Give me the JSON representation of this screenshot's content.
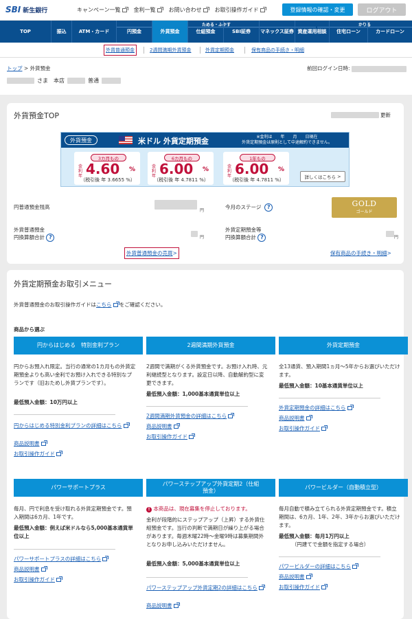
{
  "header": {
    "logo_sbi": "SBI",
    "logo_bank": "新生銀行",
    "links": [
      "キャンペーン一覧",
      "金利一覧",
      "お問い合わせ",
      "お取引操作ガイド"
    ],
    "register_button": "登録情報の確認・変更",
    "logout_button": "ログアウト"
  },
  "nav": {
    "groups": [
      "ためる・ふやす",
      "かりる"
    ],
    "items": [
      "TOP",
      "振込",
      "ATM・カード",
      "円預金",
      "外貨預金",
      "仕組預金",
      "SBI証券",
      "マネックス証券",
      "資産運用相談",
      "住宅ローン",
      "カードローン"
    ],
    "active": "外貨預金"
  },
  "subnav": {
    "items": [
      "外貨普通預金",
      "2週間満期外貨預金",
      "外貨定期預金",
      "保有商品の手続き・明細"
    ]
  },
  "breadcrumb": {
    "home": "トップ",
    "sep": " > ",
    "current": "外貨預金"
  },
  "last_login_label": "前回ログイン日時:",
  "account": {
    "honorific": "さま",
    "branch": "本店",
    "type": "普通"
  },
  "panel1": {
    "title": "外貨預金TOP",
    "updated_suffix": "更新",
    "banner": {
      "tag": "外貨預金",
      "title": "米ドル 外貨定期預金",
      "note_line1": "※金利は　　年　　月　　日現在",
      "note_line2": "外貨定期預金は原則として中途解約できません。",
      "rate_label": "金利年",
      "rates": [
        {
          "term": "3カ月もの",
          "rate": "4.60",
          "pct": "%",
          "tax": "（税引後 年 3.6655 %）"
        },
        {
          "term": "6カ月もの",
          "rate": "6.00",
          "pct": "%",
          "tax": "（税引後 年 4.7811 %）"
        },
        {
          "term": "1年もの",
          "rate": "6.00",
          "pct": "%",
          "tax": "（税引後 年 4.7811 %）"
        }
      ],
      "detail_button": "詳しくはこちら"
    },
    "yen_balance_label": "円普通預金残高",
    "fx_total_label_1": "外貨普通預金",
    "fx_total_label_2": "円換算額合計",
    "stage_label": "今月のステージ",
    "stage_value": "GOLD",
    "stage_sub": "ゴールド",
    "fixed_total_label_1": "外貨定期預金等",
    "fixed_total_label_2": "円換算額合計",
    "yen_unit": "円",
    "sale_link": "外貨普通預金の売買",
    "history_link": "保有商品の手続き・明細"
  },
  "panel2": {
    "title": "外貨定期預金お取引メニュー",
    "guide_prefix": "外貨普通預金のお取引操作ガイドは",
    "guide_link": "こちら",
    "guide_suffix": "をご確認ください。",
    "select_label": "商品から選ぶ",
    "products": [
      {
        "button": "円からはじめる　特別金利プラン",
        "desc": "円からお預入れ限定。当行の通常の1カ月もの外貨定期預金よりも高い金利でお預け入れできる特別なプランです（旧おためし外貨プランです）。",
        "min": "最低預入金額：10万円以上",
        "links": [
          "円からはじめる特別金利プランの詳細はこちら",
          "商品説明書",
          "お取引操作ガイド"
        ]
      },
      {
        "button": "2週間満期外貨預金",
        "desc": "2週間で満期がくる外貨預金です。お預け入れ時、元利継続型となります。設定日以降、自動解約型に変更できます。",
        "min": "最低預入金額：1,000基本通貨単位以上",
        "links": [
          "2週間満期外貨預金の詳細はこちら",
          "商品説明書",
          "お取引操作ガイド"
        ]
      },
      {
        "button": "外貨定期預金",
        "desc": "全13通貨、預入期間1ヵ月〜5年からお選びいただけます。",
        "min": "最低預入金額：10基本通貨単位以上",
        "links": [
          "外貨定期預金の詳細はこちら",
          "商品説明書",
          "お取引操作ガイド"
        ]
      },
      {
        "button": "パワーサポートプラス",
        "desc": "毎月、円で利息を受け取れる外貨定期預金です。預入期間は6カ月、1年です。",
        "min": "最低預入金額：例えば米ドルなら5,000基本通貨単位以上",
        "links": [
          "パワーサポートプラスの詳細はこちら",
          "商品説明書",
          "お取引操作ガイド"
        ]
      },
      {
        "button": "パワーステップアップ外貨定期2（仕組預金）",
        "warning": "本商品は、現在募集を停止しております。",
        "desc": "金利が段階的にステップアップ（上昇）する外貨仕組預金です。当行の判断で満期日が繰り上がる場合があります。毎週木曜22時〜金曜9時は募集期間外となりお申し込みいただけません。",
        "min": "最低預入金額：5,000基本通貨単位以上",
        "links": [
          "パワーステップアップ外貨定期2の詳細はこちら",
          "商品説明書"
        ]
      },
      {
        "button": "パワービルダー（自動積立型）",
        "desc": "毎月自動で積み立てられる外貨定期預金です。積立期間は、6カ月、1年、2年、3年からお選びいただけます。",
        "min": "最低預入金額：毎月1万円以上",
        "min2": "（円建てで金額を指定する場合）",
        "links": [
          "パワービルダーの詳細はこちら",
          "商品説明書",
          "お取引操作ガイド"
        ]
      }
    ]
  },
  "colors": {
    "primary": "#0b91d6",
    "nav": "#0a4f8f",
    "accent": "#c0103a",
    "gold": "#c9a84c"
  }
}
